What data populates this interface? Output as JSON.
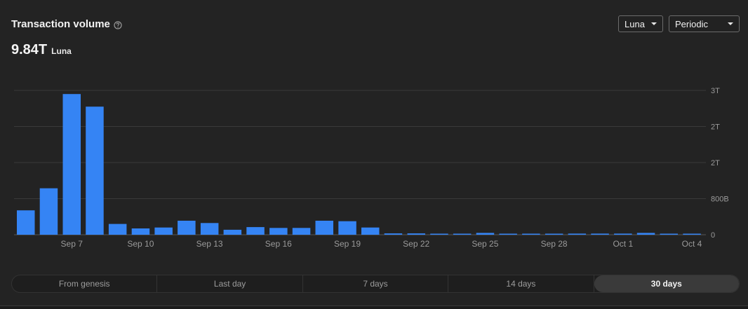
{
  "header": {
    "title": "Transaction volume",
    "total_value": "9.84T",
    "total_unit": "Luna"
  },
  "controls": {
    "currency": "Luna",
    "period": "Periodic"
  },
  "range_tabs": [
    {
      "label": "From genesis",
      "active": false
    },
    {
      "label": "Last day",
      "active": false
    },
    {
      "label": "7 days",
      "active": false
    },
    {
      "label": "14 days",
      "active": false
    },
    {
      "label": "30 days",
      "active": true
    }
  ],
  "colors": {
    "bar": "#3584f4",
    "grid": "#3a3a3a",
    "tick_text": "#9a9a9a"
  },
  "chart_data": {
    "type": "bar",
    "title": "Transaction volume",
    "unit": "Luna",
    "categories": [
      "Sep 5",
      "Sep 6",
      "Sep 7",
      "Sep 8",
      "Sep 9",
      "Sep 10",
      "Sep 11",
      "Sep 12",
      "Sep 13",
      "Sep 14",
      "Sep 15",
      "Sep 16",
      "Sep 17",
      "Sep 18",
      "Sep 19",
      "Sep 20",
      "Sep 21",
      "Sep 22",
      "Sep 23",
      "Sep 24",
      "Sep 25",
      "Sep 26",
      "Sep 27",
      "Sep 28",
      "Sep 29",
      "Sep 30",
      "Oct 1",
      "Oct 2",
      "Oct 3",
      "Oct 4"
    ],
    "x_tick_labels": [
      "Sep 7",
      "Sep 10",
      "Sep 13",
      "Sep 16",
      "Sep 19",
      "Sep 22",
      "Sep 25",
      "Sep 28",
      "Oct 1",
      "Oct 4"
    ],
    "values": [
      540,
      1030,
      3120,
      2840,
      240,
      140,
      160,
      310,
      260,
      110,
      170,
      150,
      150,
      310,
      300,
      160,
      30,
      30,
      20,
      10,
      40,
      20,
      10,
      10,
      25,
      25,
      25,
      40,
      20,
      15
    ],
    "value_unit": "B",
    "y_tick_labels": [
      "0",
      "800B",
      "2T",
      "2T",
      "3T"
    ],
    "y_tick_values": [
      0,
      800,
      1600,
      2400,
      3200
    ],
    "ylim": [
      0,
      3200
    ],
    "grid": true,
    "legend": "none"
  }
}
